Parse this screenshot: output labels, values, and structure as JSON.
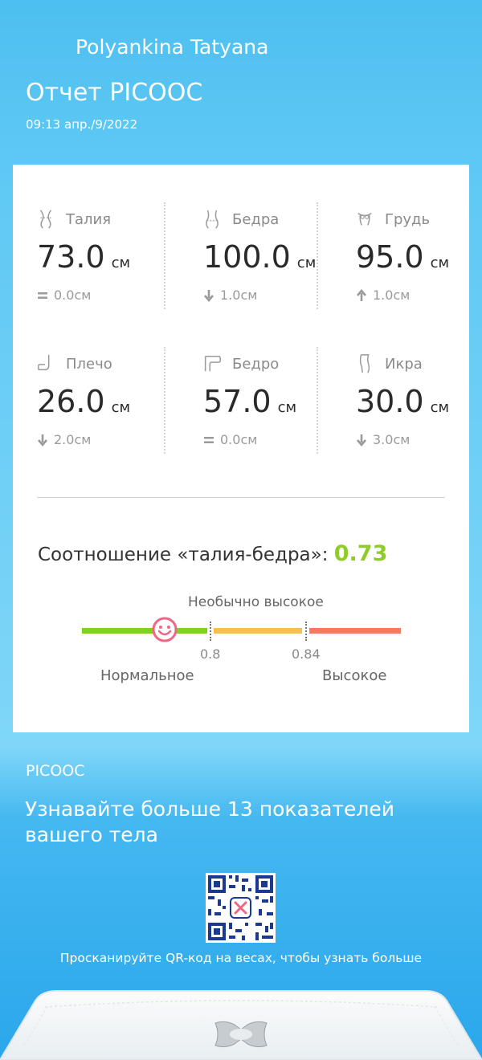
{
  "header": {
    "user_name": "Polyankina Tatyana",
    "report_title": "Отчет PICOOC",
    "date": "09:13 апр./9/2022"
  },
  "measurements": [
    {
      "label": "Талия",
      "value": "73.0",
      "unit": "см",
      "change": "0.0см",
      "trend": "equal",
      "icon": "waist-icon"
    },
    {
      "label": "Бедра",
      "value": "100.0",
      "unit": "см",
      "change": "1.0см",
      "trend": "down",
      "icon": "hips-icon"
    },
    {
      "label": "Грудь",
      "value": "95.0",
      "unit": "см",
      "change": "1.0см",
      "trend": "up",
      "icon": "chest-icon"
    },
    {
      "label": "Плечо",
      "value": "26.0",
      "unit": "см",
      "change": "2.0см",
      "trend": "down",
      "icon": "arm-icon"
    },
    {
      "label": "Бедро",
      "value": "57.0",
      "unit": "см",
      "change": "0.0см",
      "trend": "equal",
      "icon": "thigh-icon"
    },
    {
      "label": "Икра",
      "value": "30.0",
      "unit": "см",
      "change": "3.0см",
      "trend": "down",
      "icon": "calf-icon"
    }
  ],
  "whr": {
    "label": "Соотношение «талия-бедра»:",
    "value": "0.73",
    "value_color": "#8fcc2a",
    "scale_top_label": "Необычно высокое",
    "tick_1": "0.8",
    "tick_2": "0.84",
    "zone_normal": "Нормальное",
    "zone_high": "Высокое",
    "colors": {
      "normal": "#7ed321",
      "elevated": "#f6bf4f",
      "high": "#f57a5e",
      "marker": "#f06786"
    }
  },
  "promo": {
    "brand": "PICOOC",
    "headline": "Узнавайте больше 13 показателей вашего тела",
    "qr_caption": "Просканируйте QR-код на весах, чтобы узнать больше"
  }
}
